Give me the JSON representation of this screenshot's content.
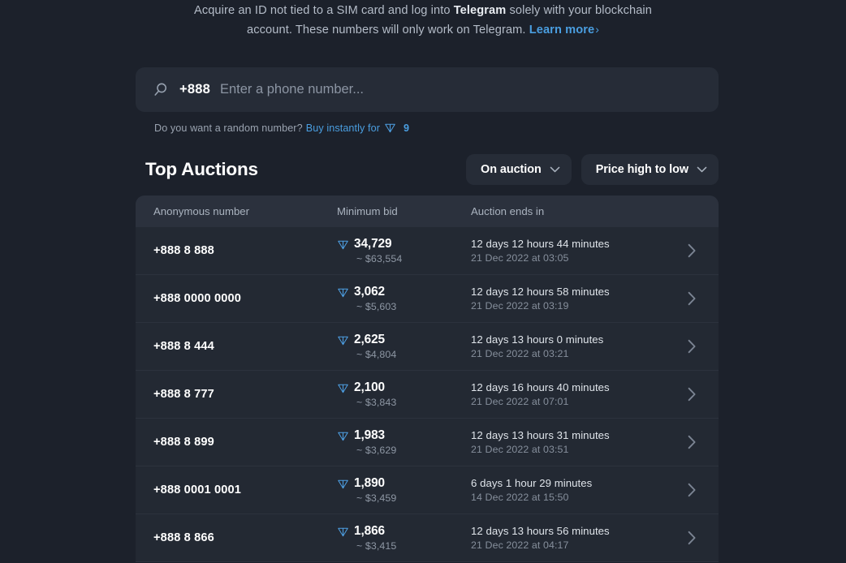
{
  "intro": {
    "line1_a": "Acquire an ID not tied to a SIM card and log into ",
    "brand": "Telegram",
    "line1_b": " solely with your blockchain",
    "line2": "account. These numbers will only work on Telegram.",
    "learn_more": "Learn more",
    "learn_more_chevron": "›"
  },
  "search": {
    "icon": "search-icon",
    "prefix": "+888",
    "value": "",
    "placeholder": "Enter a phone number..."
  },
  "random": {
    "question": "Do you want a random number?",
    "buy_label": "Buy instantly for",
    "currency_icon": "ton-diamond-icon",
    "price": "9"
  },
  "section": {
    "title": "Top Auctions",
    "filters": [
      {
        "label": "On auction",
        "icon": "chevron-down-icon"
      },
      {
        "label": "Price high to low",
        "icon": "chevron-down-icon"
      }
    ]
  },
  "table": {
    "columns": [
      "Anonymous number",
      "Minimum bid",
      "Auction ends in"
    ],
    "rows": [
      {
        "number": "+888 8 888",
        "bid_ton": "34,729",
        "bid_usd": "~ $63,554",
        "ends_in": "12 days 12 hours 44 minutes",
        "ends_at": "21 Dec 2022 at 03:05"
      },
      {
        "number": "+888 0000 0000",
        "bid_ton": "3,062",
        "bid_usd": "~ $5,603",
        "ends_in": "12 days 12 hours 58 minutes",
        "ends_at": "21 Dec 2022 at 03:19"
      },
      {
        "number": "+888 8 444",
        "bid_ton": "2,625",
        "bid_usd": "~ $4,804",
        "ends_in": "12 days 13 hours 0 minutes",
        "ends_at": "21 Dec 2022 at 03:21"
      },
      {
        "number": "+888 8 777",
        "bid_ton": "2,100",
        "bid_usd": "~ $3,843",
        "ends_in": "12 days 16 hours 40 minutes",
        "ends_at": "21 Dec 2022 at 07:01"
      },
      {
        "number": "+888 8 899",
        "bid_ton": "1,983",
        "bid_usd": "~ $3,629",
        "ends_in": "12 days 13 hours 31 minutes",
        "ends_at": "21 Dec 2022 at 03:51"
      },
      {
        "number": "+888 0001 0001",
        "bid_ton": "1,890",
        "bid_usd": "~ $3,459",
        "ends_in": "6 days 1 hour 29 minutes",
        "ends_at": "14 Dec 2022 at 15:50"
      },
      {
        "number": "+888 8 866",
        "bid_ton": "1,866",
        "bid_usd": "~ $3,415",
        "ends_in": "12 days 13 hours 56 minutes",
        "ends_at": "21 Dec 2022 at 04:17"
      }
    ]
  },
  "colors": {
    "page_bg": "#1c212b",
    "surface": "#232933",
    "header_row": "#2b313d",
    "input_bg": "#262c37",
    "accent_blue": "#4a9ee0",
    "ton_blue": "#4ea1e6",
    "text_primary": "#ffffff",
    "text_muted": "#8d96a3"
  }
}
